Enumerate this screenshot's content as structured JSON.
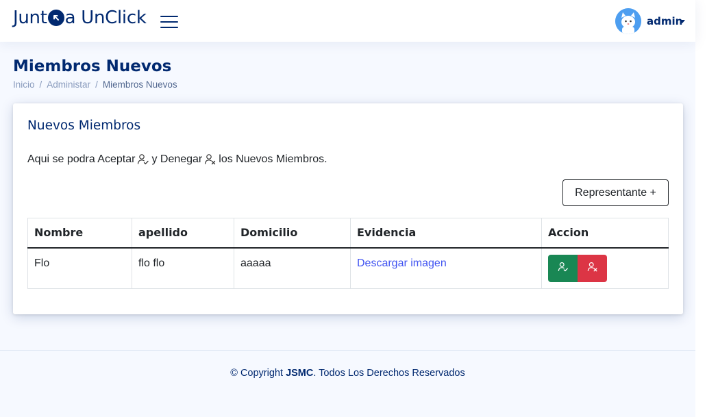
{
  "header": {
    "logo_part1": "Junt",
    "logo_part2": " a UnClick",
    "logo_icon": "arrow-up-left-circle-icon",
    "menu_icon": "hamburger-menu-icon",
    "user_name": "admin",
    "avatar_icon": "cat-avatar"
  },
  "page": {
    "title": "Miembros Nuevos",
    "breadcrumb": [
      "Inicio",
      "Administar",
      "Miembros Nuevos"
    ],
    "breadcrumb_sep": "/"
  },
  "card": {
    "title": "Nuevos Miembros",
    "desc_part1": "Aqui se podra Aceptar",
    "desc_part2": "y Denegar",
    "desc_part3": "los Nuevos Miembros.",
    "add_button": "Representante +"
  },
  "table": {
    "columns": [
      "Nombre",
      "apellido",
      "Domicilio",
      "Evidencia",
      "Accion"
    ],
    "rows": [
      {
        "nombre": "Flo",
        "apellido": "flo flo",
        "domicilio": "aaaaa",
        "evidencia": "Descargar imagen",
        "accept_icon": "person-check-icon",
        "reject_icon": "person-x-icon"
      }
    ]
  },
  "footer": {
    "prefix": "© Copyright ",
    "brand": "JSMC",
    "suffix": ". Todos Los Derechos Reservados"
  },
  "colors": {
    "primary": "#012970",
    "accent": "#4154f1",
    "success": "#198754",
    "danger": "#dc3545",
    "page_bg": "#f6f9ff"
  }
}
